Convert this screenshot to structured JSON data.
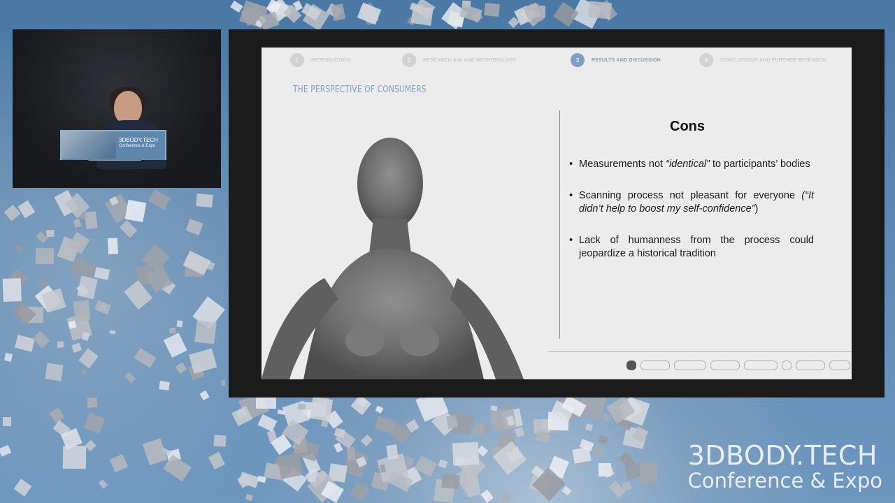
{
  "speaker": {
    "podium_logo": "3DBODY.TECH",
    "podium_subtitle": "Conference & Expo",
    "podium_small_1": "",
    "podium_small_2": ""
  },
  "slide": {
    "progress": [
      {
        "number": "1",
        "label": "INTRODUCTION",
        "active": false
      },
      {
        "number": "2",
        "label": "RESEARCH AIM AND METHODOLOGY",
        "active": false
      },
      {
        "number": "3",
        "label": "RESULTS AND DISCUSSION",
        "active": true
      },
      {
        "number": "4",
        "label": "CONCLUSIONS AND FURTHER RESEARCH",
        "active": false
      }
    ],
    "title": "THE PERSPECTIVE OF CONSUMERS",
    "heading": "Cons",
    "bullet": "•",
    "items": [
      {
        "before": "Measurements not ",
        "em": "“identical”",
        "after": " to participants’ bodies"
      },
      {
        "before": "Scanning process not pleasant for everyone ",
        "em": "(“It didn’t help to boost my self-confidence”",
        "after": ")"
      },
      {
        "before": "Lack of humanness from the process could jeopardize a historical tradition",
        "em": "",
        "after": ""
      }
    ]
  },
  "brand": {
    "line1": "3DBODY.TECH",
    "line2": "Conference & Expo"
  },
  "colors": {
    "accent": "#7ea1c6",
    "background_blue": "#4a78a4",
    "slide_bg": "#ececec"
  }
}
